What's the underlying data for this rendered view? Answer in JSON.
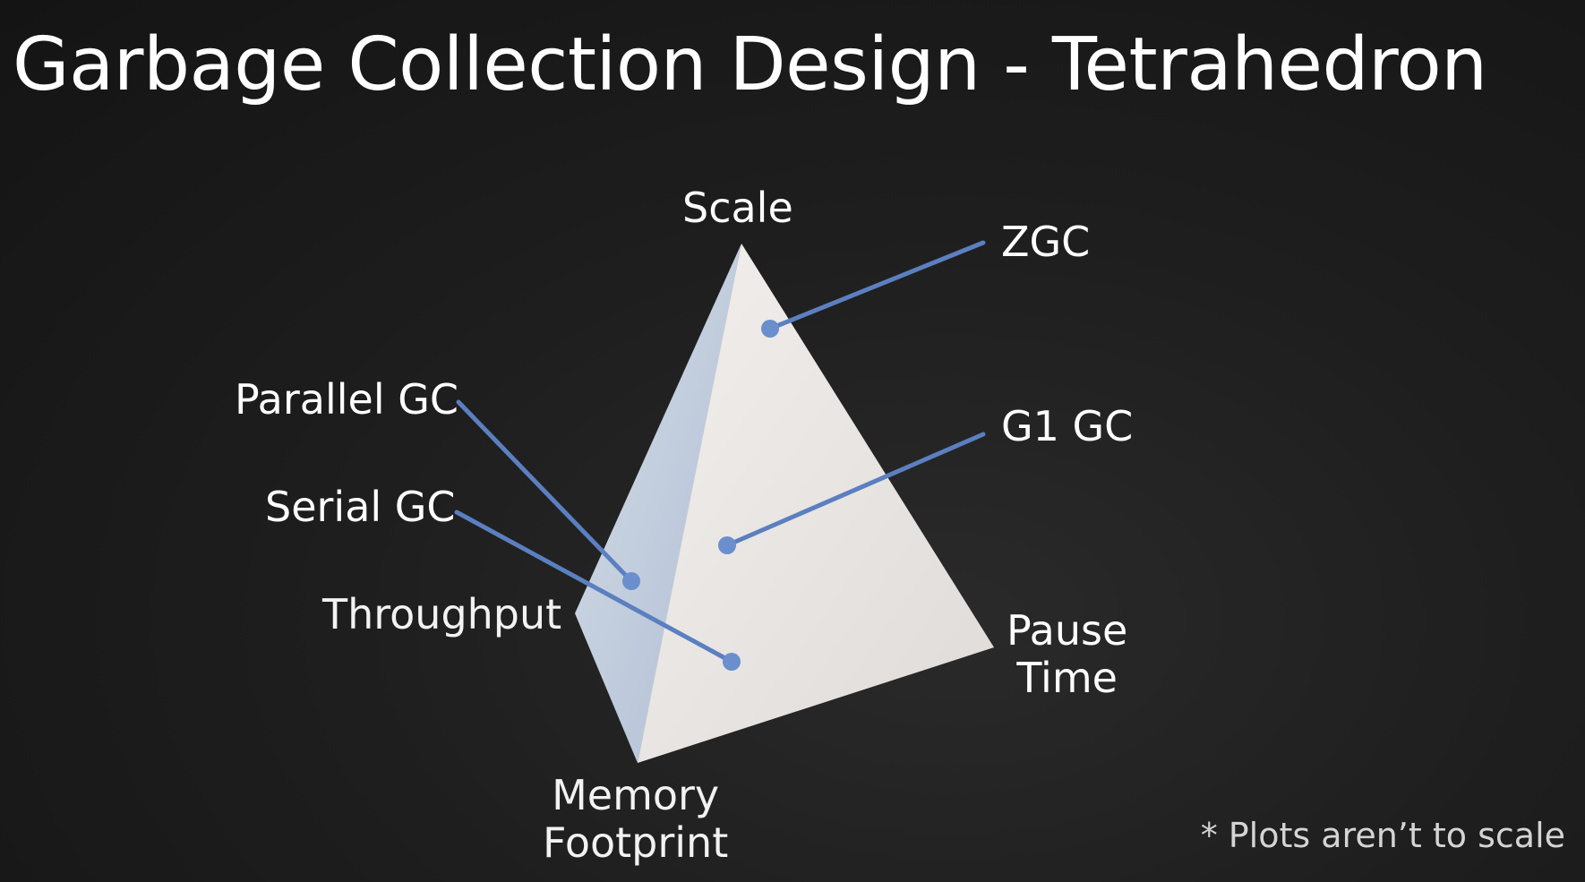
{
  "slide": {
    "title": "Garbage Collection Design - Tetrahedron",
    "footnote": "* Plots aren’t to scale"
  },
  "vertices": {
    "top": "Scale",
    "left": "Throughput",
    "right_line1": "Pause",
    "right_line2": "Time",
    "bottom_line1": "Memory",
    "bottom_line2": "Footprint"
  },
  "collectors": [
    {
      "name": "ZGC"
    },
    {
      "name": "G1 GC"
    },
    {
      "name": "Parallel GC"
    },
    {
      "name": "Serial GC"
    }
  ],
  "colors": {
    "leader_line": "#5b7fc0",
    "dot": "#6a8fcc",
    "face_light": "#ece8e4",
    "face_shadow": "#b8c6d8"
  }
}
